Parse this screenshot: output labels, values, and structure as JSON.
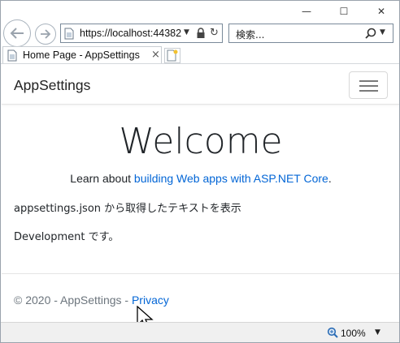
{
  "browser": {
    "caption": {
      "minimize": "—",
      "maximize": "☐",
      "close": "✕"
    },
    "address": {
      "url": "https://localhost:44382"
    },
    "search": {
      "placeholder": "検索..."
    },
    "tab": {
      "title": "Home Page - AppSettings",
      "close": "×"
    },
    "status": {
      "zoom": "100%"
    }
  },
  "page": {
    "brand": "AppSettings",
    "heading": "Welcome",
    "learn_prefix": "Learn about ",
    "learn_link": "building Web apps with ASP.NET Core",
    "learn_suffix": ".",
    "line1": "appsettings.json から取得したテキストを表示",
    "line2": "Development です。",
    "footer_text": "© 2020 - AppSettings - ",
    "footer_link": "Privacy"
  },
  "colors": {
    "link": "#0366d6",
    "text": "#212529",
    "muted": "#6c757d"
  },
  "icons": [
    "back-arrow-icon",
    "forward-arrow-icon",
    "page-icon",
    "lock-icon",
    "refresh-icon",
    "search-icon",
    "new-tab-icon",
    "hamburger-icon",
    "zoom-icon",
    "mouse-cursor"
  ]
}
